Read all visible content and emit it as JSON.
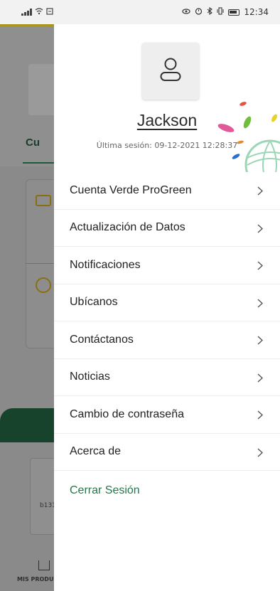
{
  "status_bar": {
    "time": "12:34",
    "icons": [
      "signal-icon",
      "wifi-icon",
      "sim-icon",
      "eye-icon",
      "alarm-icon",
      "bluetooth-icon",
      "vibrate-icon",
      "battery-icon"
    ]
  },
  "background": {
    "tab_label": "Cu",
    "card_text": "b131",
    "bottom_nav_label": "MIS PRODU"
  },
  "drawer": {
    "profile": {
      "name": "Jackson",
      "last_session": "Última sesión: 09-12-2021 12:28:37"
    },
    "menu_items": [
      {
        "label": "Cuenta Verde ProGreen"
      },
      {
        "label": "Actualización de Datos"
      },
      {
        "label": "Notificaciones"
      },
      {
        "label": "Ubícanos"
      },
      {
        "label": "Contáctanos"
      },
      {
        "label": "Noticias"
      },
      {
        "label": "Cambio de contraseña"
      },
      {
        "label": "Acerca de"
      }
    ],
    "logout_label": "Cerrar Sesión"
  },
  "colors": {
    "accent_green": "#1f7a4a",
    "dark_green": "#17422c",
    "gold": "#a8961f"
  }
}
